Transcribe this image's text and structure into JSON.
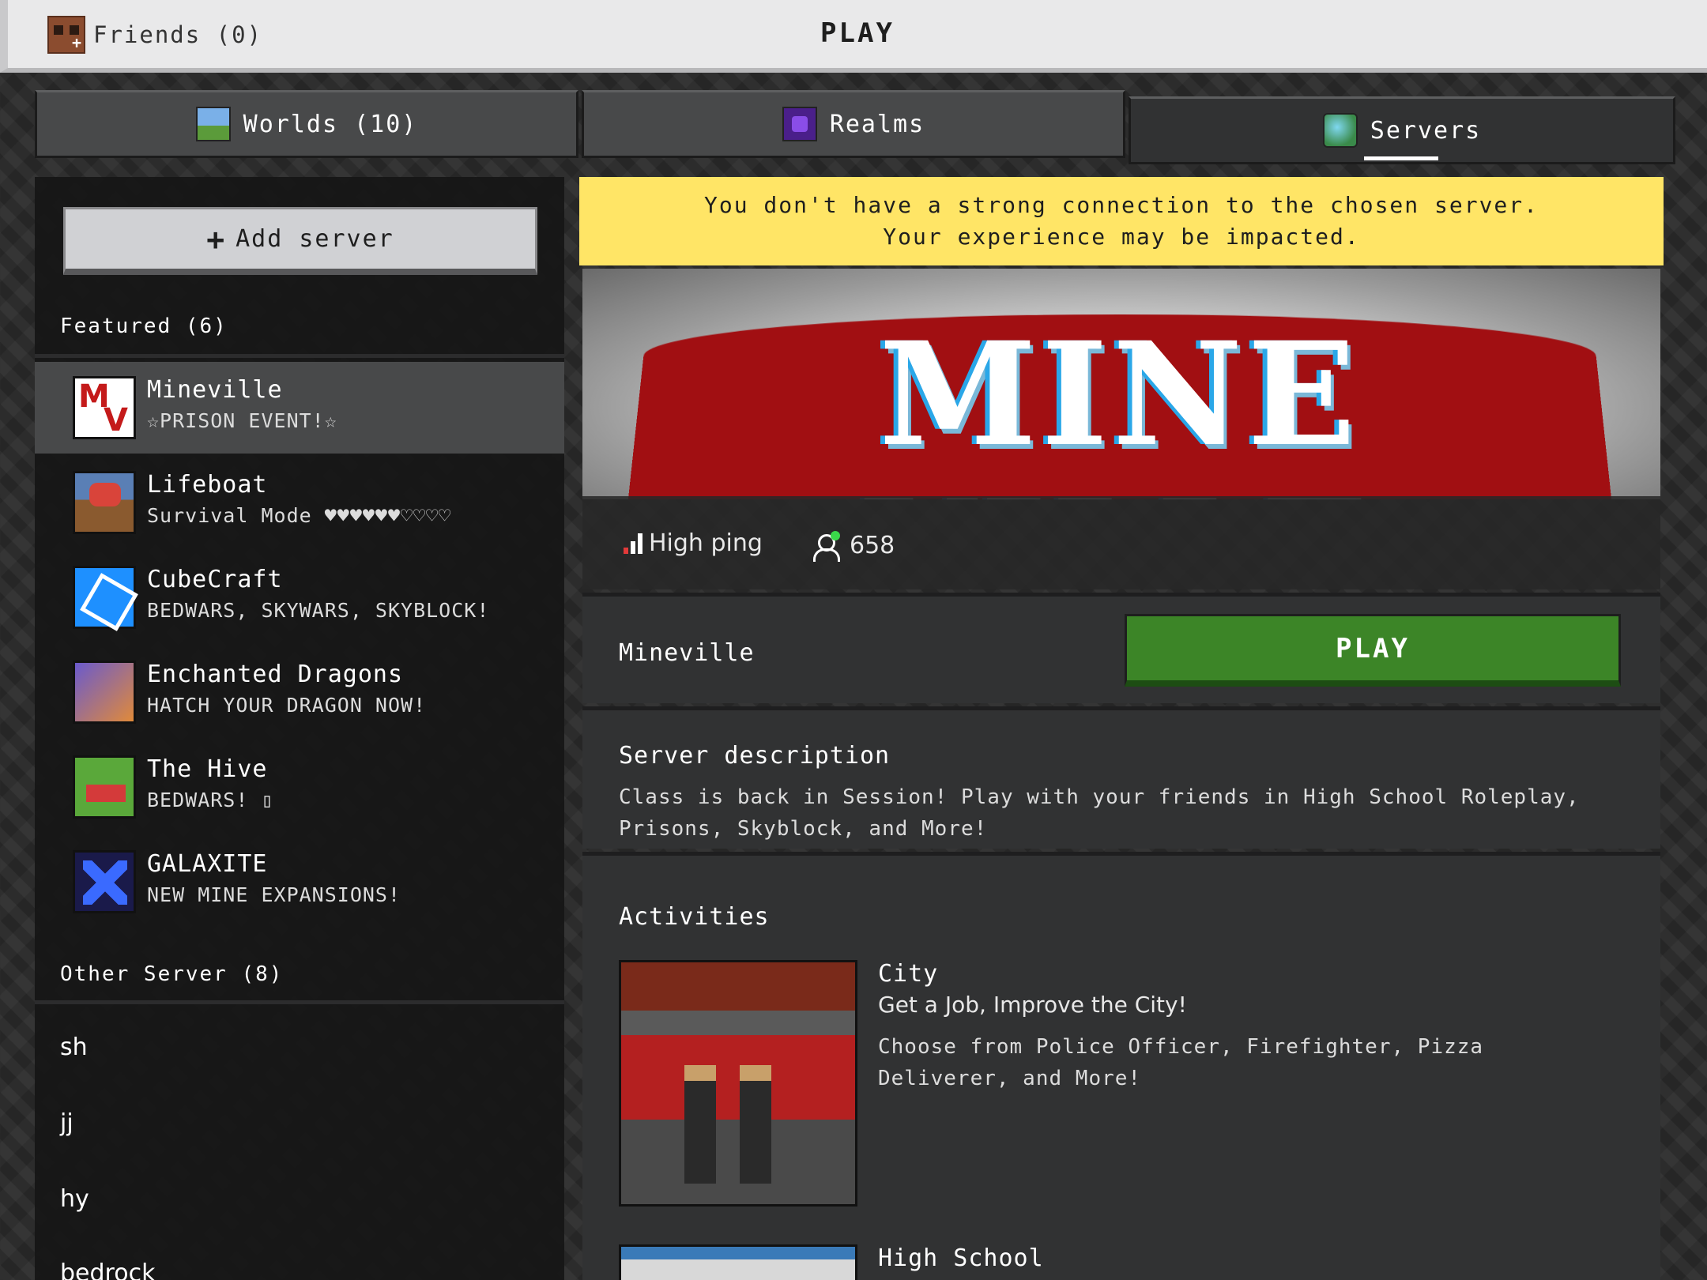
{
  "topbar": {
    "friends_label": "Friends (0)",
    "title": "PLAY"
  },
  "tabs": [
    {
      "label": "Worlds (10)",
      "icon": "world-icon"
    },
    {
      "label": "Realms",
      "icon": "realm-icon"
    },
    {
      "label": "Servers",
      "icon": "server-icon",
      "selected": true
    }
  ],
  "sidebar": {
    "add_server_label": "Add server",
    "featured_heading": "Featured (6)",
    "featured": [
      {
        "name": "Mineville",
        "subtitle": "☆PRISON EVENT!☆",
        "selected": true
      },
      {
        "name": "Lifeboat",
        "subtitle": "Survival Mode ♥♥♥♥♥♥♡♡♡♡"
      },
      {
        "name": "CubeCraft",
        "subtitle": "BEDWARS, SKYWARS, SKYBLOCK!"
      },
      {
        "name": "Enchanted Dragons",
        "subtitle": "HATCH YOUR DRAGON NOW!"
      },
      {
        "name": "The Hive",
        "subtitle": "BEDWARS! ▯"
      },
      {
        "name": "GALAXITE",
        "subtitle": "NEW MINE EXPANSIONS!"
      }
    ],
    "other_heading": "Other Server (8)",
    "other": [
      "sh",
      "jj",
      "hy",
      "bedrock"
    ]
  },
  "detail": {
    "warning": "You don't have a strong connection to the chosen server. Your experience may be impacted.",
    "banner_text": "MINE VILLE",
    "ping_label": "High ping",
    "player_count": "658",
    "server_name": "Mineville",
    "play_label": "PLAY",
    "description_heading": "Server description",
    "description": "Class is back in Session! Play with your friends in High School Roleplay, Prisons, Skyblock, and More!",
    "activities_heading": "Activities",
    "activities": [
      {
        "title": "City",
        "subtitle": "Get a Job, Improve the City!",
        "description": "Choose from Police Officer, Firefighter, Pizza Deliverer, and More!"
      },
      {
        "title": "High School"
      }
    ]
  },
  "colors": {
    "warning_bg": "#ffe566",
    "play_green": "#3c8527",
    "panel_bg": "#313233",
    "selected_bg": "#48494a"
  }
}
